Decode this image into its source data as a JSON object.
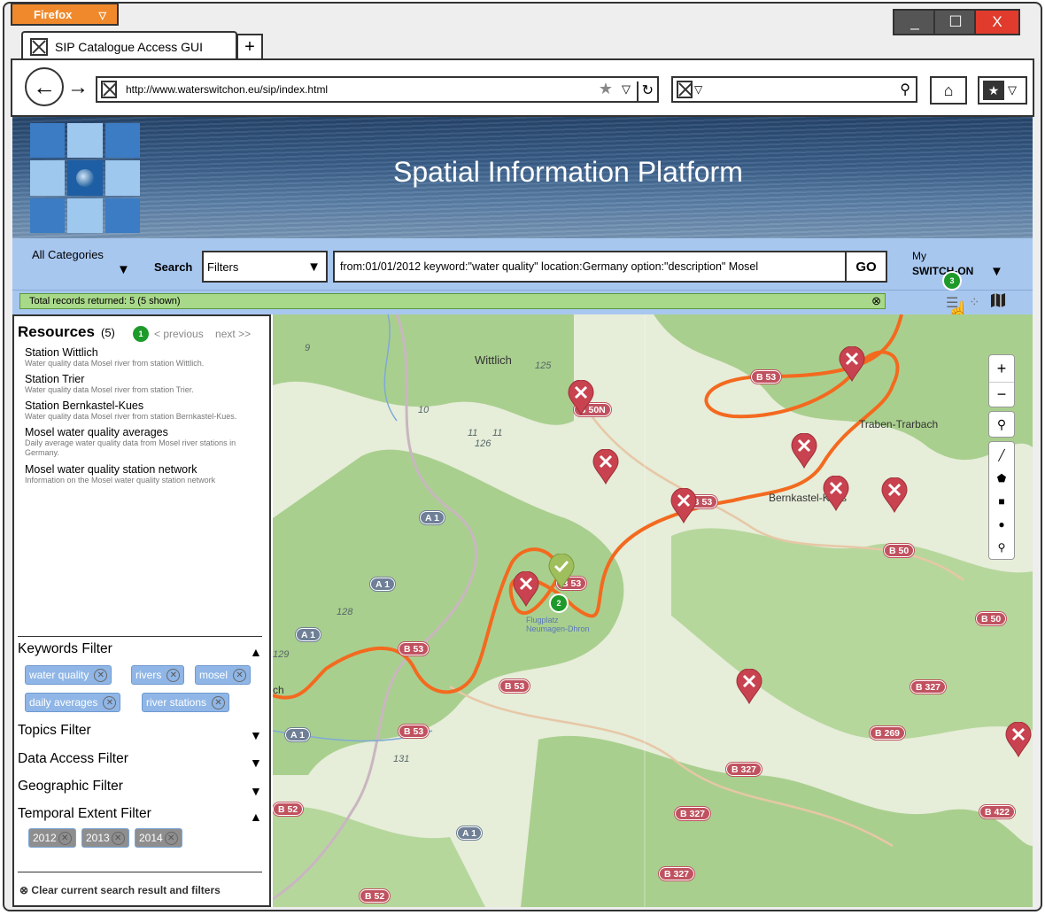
{
  "browser": {
    "app_button": "Firefox",
    "tab_title": "SIP Catalogue Access GUI",
    "url": "http://www.waterswitchon.eu/sip/index.html",
    "controls": {
      "minimize": "_",
      "maximize": "☐",
      "close": "X"
    }
  },
  "header": {
    "title": "Spatial Information Platform"
  },
  "toolbar": {
    "categories_label": "All Categories",
    "search_label": "Search",
    "filters_value": "Filters",
    "query_value": "from:01/01/2012 keyword:\"water quality\" location:Germany option:\"description\" Mosel",
    "go_label": "GO",
    "my_label": "My",
    "switchon_label": "SWITCH-ON"
  },
  "status": {
    "records_text": "Total records returned: 5 (5 shown)"
  },
  "resources": {
    "title": "Resources",
    "count": "(5)",
    "previous": "< previous",
    "next": "next >>",
    "items": [
      {
        "title": "Station Wittlich",
        "desc": "Water quality data Mosel river from station Wittlich."
      },
      {
        "title": "Station Trier",
        "desc": "Water quality data Mosel river from station Trier."
      },
      {
        "title": "Station Bernkastel-Kues",
        "desc": "Water quality data Mosel river from station Bernkastel-Kues."
      },
      {
        "title": "Mosel water quality averages",
        "desc": "Daily average water quality data from Mosel river stations in Germany."
      },
      {
        "title": "Mosel water quality station network",
        "desc": "Information on the Mosel water quality station network"
      }
    ]
  },
  "filters": {
    "keywords": {
      "label": "Keywords Filter",
      "chips": [
        "water quality",
        "rivers",
        "mosel",
        "daily averages",
        "river stations"
      ]
    },
    "topics": {
      "label": "Topics Filter"
    },
    "data_access": {
      "label": "Data Access Filter"
    },
    "geographic": {
      "label": "Geographic Filter"
    },
    "temporal": {
      "label": "Temporal Extent Filter",
      "chips": [
        "2012",
        "2013",
        "2014"
      ]
    },
    "clear_label": "Clear current search result and filters"
  },
  "badges": {
    "b1": "1",
    "b2": "2",
    "b3": "3"
  },
  "map": {
    "places": [
      "Wittlich",
      "Traben-Trarbach",
      "Bernkastel-Kues",
      "Flugplatz Neumagen-Dhron",
      "ch"
    ],
    "roads": {
      "b50n": "B 50N",
      "b53a": "B 53",
      "b53b": "B 53",
      "b53c": "B 53",
      "b53d": "B 53",
      "b53e": "B 53",
      "b53f": "B 53",
      "b50a": "B 50",
      "b50b": "B 50",
      "b327a": "B 327",
      "b327b": "B 327",
      "b327c": "B 327",
      "b327d": "B 327",
      "b269": "B 269",
      "b422": "B 422",
      "b52a": "B 52",
      "b52b": "B 52",
      "a1a": "A 1",
      "a1b": "A 1",
      "a1c": "A 1",
      "a1d": "A 1",
      "a1e": "A 1"
    },
    "road_numbers": [
      "9",
      "125",
      "10",
      "11",
      "11",
      "126",
      "128",
      "129",
      "131"
    ],
    "colors": {
      "river": "#f36a1f",
      "marker_red": "#c8434f",
      "marker_green": "#9fbf5c"
    }
  }
}
